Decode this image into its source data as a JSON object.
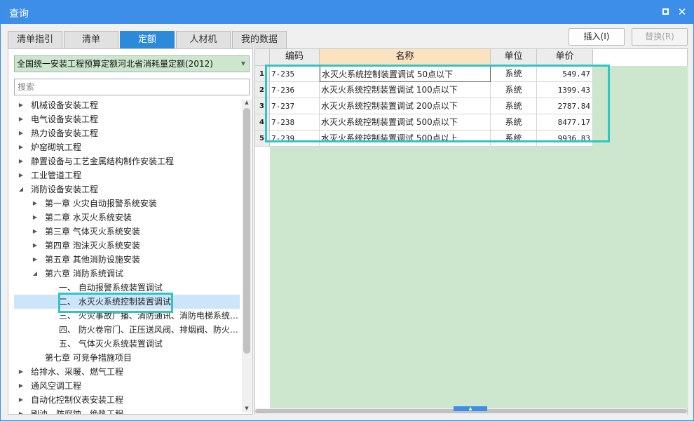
{
  "window": {
    "title": "查询",
    "restore_icon": "restore-icon",
    "close_glyph": "✕"
  },
  "tabs": [
    {
      "label": "清单指引",
      "active": false
    },
    {
      "label": "清单",
      "active": false
    },
    {
      "label": "定额",
      "active": true
    },
    {
      "label": "人材机",
      "active": false
    },
    {
      "label": "我的数据",
      "active": false
    }
  ],
  "actions": {
    "insert_label": "插入(I)",
    "replace_label": "替换(R)"
  },
  "left": {
    "quota_library": "全国统一安装工程预算定额河北省消耗量定额(2012)",
    "search_placeholder": "搜索",
    "tree": [
      {
        "label": "机械设备安装工程",
        "exp": "▶",
        "level": 0
      },
      {
        "label": "电气设备安装工程",
        "exp": "▶",
        "level": 0
      },
      {
        "label": "热力设备安装工程",
        "exp": "▶",
        "level": 0
      },
      {
        "label": "炉窑砌筑工程",
        "exp": "▶",
        "level": 0
      },
      {
        "label": "静置设备与工艺金属结构制作安装工程",
        "exp": "▶",
        "level": 0
      },
      {
        "label": "工业管道工程",
        "exp": "▶",
        "level": 0
      },
      {
        "label": "消防设备安装工程",
        "exp": "◢",
        "level": 0
      },
      {
        "label": "第一章 火灾自动报警系统安装",
        "exp": "▶",
        "level": 1
      },
      {
        "label": "第二章 水灭火系统安装",
        "exp": "▶",
        "level": 1
      },
      {
        "label": "第三章 气体灭火系统安装",
        "exp": "▶",
        "level": 1
      },
      {
        "label": "第四章 泡沫灭火系统安装",
        "exp": "▶",
        "level": 1
      },
      {
        "label": "第五章 其他消防设施安装",
        "exp": "▶",
        "level": 1
      },
      {
        "label": "第六章 消防系统调试",
        "exp": "◢",
        "level": 1
      },
      {
        "label": "一、 自动报警系统装置调试",
        "exp": "",
        "level": 2
      },
      {
        "label": "二、 水灭火系统控制装置调试",
        "exp": "",
        "level": 2,
        "selected": true
      },
      {
        "label": "三、 火灾事故广播、消防通讯、消防电梯系统…",
        "exp": "",
        "level": 2
      },
      {
        "label": "四、 防火卷帘门、正压送风阀、排烟阀、防火…",
        "exp": "",
        "level": 2
      },
      {
        "label": "五、 气体灭火系统装置调试",
        "exp": "",
        "level": 2
      },
      {
        "label": "第七章 可竞争措施项目",
        "exp": "",
        "level": 1
      },
      {
        "label": "给排水、采暖、燃气工程",
        "exp": "▶",
        "level": 0
      },
      {
        "label": "通风空调工程",
        "exp": "▶",
        "level": 0
      },
      {
        "label": "自动化控制仪表安装工程",
        "exp": "▶",
        "level": 0
      },
      {
        "label": "刷油、防腐蚀、绝热工程",
        "exp": "▶",
        "level": 0
      }
    ]
  },
  "grid": {
    "headers": {
      "code": "编码",
      "name": "名称",
      "unit": "单位",
      "price": "单价"
    },
    "rows": [
      {
        "num": "1",
        "code": "7-235",
        "name": "水灭火系统控制装置调试 50点以下",
        "unit": "系统",
        "price": "549.47"
      },
      {
        "num": "2",
        "code": "7-236",
        "name": "水灭火系统控制装置调试 100点以下",
        "unit": "系统",
        "price": "1399.43"
      },
      {
        "num": "3",
        "code": "7-237",
        "name": "水灭火系统控制装置调试 200点以下",
        "unit": "系统",
        "price": "2787.84"
      },
      {
        "num": "4",
        "code": "7-238",
        "name": "水灭火系统控制装置调试 500点以下",
        "unit": "系统",
        "price": "8477.17"
      },
      {
        "num": "5",
        "code": "7-239",
        "name": "水灭火系统控制装置调试 500点以上",
        "unit": "系统",
        "price": "9936.83"
      }
    ]
  },
  "colors": {
    "titlebar": "#3d8ee8",
    "active_tab": "#2b8ad9",
    "highlight_box": "#2ec5c5",
    "green_fill": "#cde7cf"
  }
}
